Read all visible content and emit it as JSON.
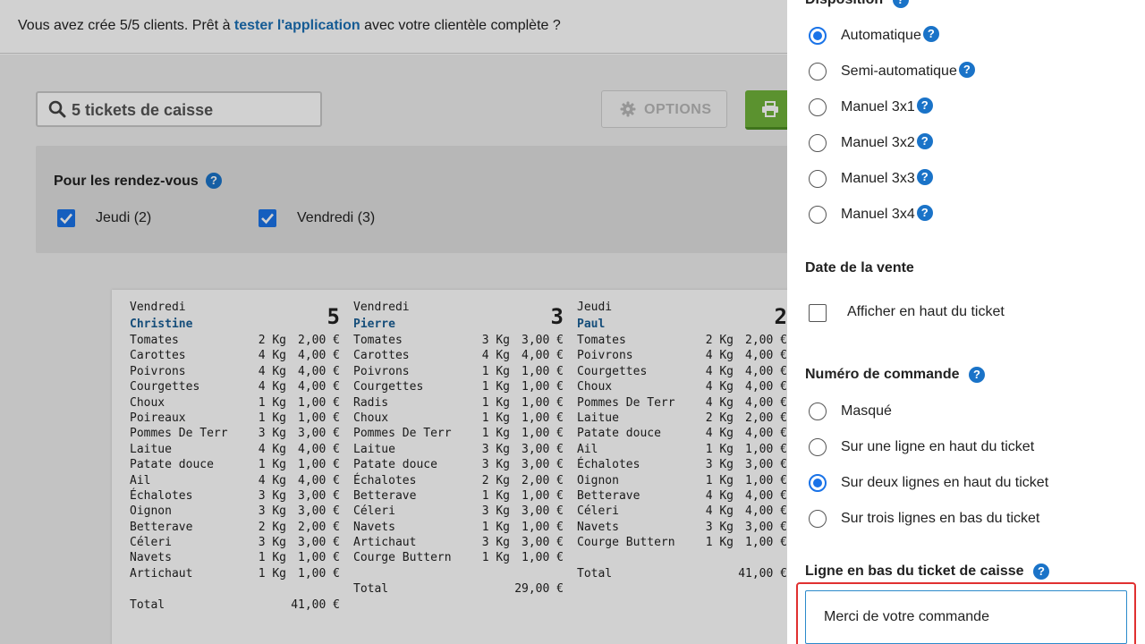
{
  "banner": {
    "text_before": "Vous avez crée 5/5 clients. Prêt à ",
    "link": "tester l'application",
    "text_after": " avec votre clientèle complète ?"
  },
  "toolbar": {
    "search_value": "5 tickets de caisse",
    "options_label": "OPTIONS"
  },
  "filters": {
    "title": "Pour les rendez-vous",
    "days": [
      {
        "label": "Jeudi (2)",
        "checked": true
      },
      {
        "label": "Vendredi (3)",
        "checked": true
      }
    ]
  },
  "tickets": [
    {
      "day": "Vendredi",
      "number": "5",
      "client": "Christine",
      "items": [
        [
          "Tomates",
          "2 Kg",
          "2,00 €"
        ],
        [
          "Carottes",
          "4 Kg",
          "4,00 €"
        ],
        [
          "Poivrons",
          "4 Kg",
          "4,00 €"
        ],
        [
          "Courgettes",
          "4 Kg",
          "4,00 €"
        ],
        [
          "Choux",
          "1 Kg",
          "1,00 €"
        ],
        [
          "Poireaux",
          "1 Kg",
          "1,00 €"
        ],
        [
          "Pommes De Terr",
          "3 Kg",
          "3,00 €"
        ],
        [
          "Laitue",
          "4 Kg",
          "4,00 €"
        ],
        [
          "Patate douce",
          "1 Kg",
          "1,00 €"
        ],
        [
          "Ail",
          "4 Kg",
          "4,00 €"
        ],
        [
          "Échalotes",
          "3 Kg",
          "3,00 €"
        ],
        [
          "Oignon",
          "3 Kg",
          "3,00 €"
        ],
        [
          "Betterave",
          "2 Kg",
          "2,00 €"
        ],
        [
          "Céleri",
          "3 Kg",
          "3,00 €"
        ],
        [
          "Navets",
          "1 Kg",
          "1,00 €"
        ],
        [
          "Artichaut",
          "1 Kg",
          "1,00 €"
        ]
      ],
      "total_label": "Total",
      "total": "41,00 €"
    },
    {
      "day": "Vendredi",
      "number": "3",
      "client": "Pierre",
      "items": [
        [
          "Tomates",
          "3 Kg",
          "3,00 €"
        ],
        [
          "Carottes",
          "4 Kg",
          "4,00 €"
        ],
        [
          "Poivrons",
          "1 Kg",
          "1,00 €"
        ],
        [
          "Courgettes",
          "1 Kg",
          "1,00 €"
        ],
        [
          "Radis",
          "1 Kg",
          "1,00 €"
        ],
        [
          "Choux",
          "1 Kg",
          "1,00 €"
        ],
        [
          "Pommes De Terr",
          "1 Kg",
          "1,00 €"
        ],
        [
          "Laitue",
          "3 Kg",
          "3,00 €"
        ],
        [
          "Patate douce",
          "3 Kg",
          "3,00 €"
        ],
        [
          "Échalotes",
          "2 Kg",
          "2,00 €"
        ],
        [
          "Betterave",
          "1 Kg",
          "1,00 €"
        ],
        [
          "Céleri",
          "3 Kg",
          "3,00 €"
        ],
        [
          "Navets",
          "1 Kg",
          "1,00 €"
        ],
        [
          "Artichaut",
          "3 Kg",
          "3,00 €"
        ],
        [
          "Courge Buttern",
          "1 Kg",
          "1,00 €"
        ]
      ],
      "total_label": "Total",
      "total": "29,00 €"
    },
    {
      "day": "Jeudi",
      "number": "2",
      "client": "Paul",
      "items": [
        [
          "Tomates",
          "2 Kg",
          "2,00 €"
        ],
        [
          "Poivrons",
          "4 Kg",
          "4,00 €"
        ],
        [
          "Courgettes",
          "4 Kg",
          "4,00 €"
        ],
        [
          "Choux",
          "4 Kg",
          "4,00 €"
        ],
        [
          "Pommes De Terr",
          "4 Kg",
          "4,00 €"
        ],
        [
          "Laitue",
          "2 Kg",
          "2,00 €"
        ],
        [
          "Patate douce",
          "4 Kg",
          "4,00 €"
        ],
        [
          "Ail",
          "1 Kg",
          "1,00 €"
        ],
        [
          "Échalotes",
          "3 Kg",
          "3,00 €"
        ],
        [
          "Oignon",
          "1 Kg",
          "1,00 €"
        ],
        [
          "Betterave",
          "4 Kg",
          "4,00 €"
        ],
        [
          "Céleri",
          "4 Kg",
          "4,00 €"
        ],
        [
          "Navets",
          "3 Kg",
          "3,00 €"
        ],
        [
          "Courge Buttern",
          "1 Kg",
          "1,00 €"
        ]
      ],
      "total_label": "Total",
      "total": "41,00 €"
    }
  ],
  "panel": {
    "disposition": {
      "title": "Disposition",
      "options": [
        {
          "label": "Automatique",
          "selected": true,
          "help": true
        },
        {
          "label": "Semi-automatique",
          "selected": false,
          "help": true
        },
        {
          "label": "Manuel 3x1",
          "selected": false,
          "help": true
        },
        {
          "label": "Manuel 3x2",
          "selected": false,
          "help": true
        },
        {
          "label": "Manuel 3x3",
          "selected": false,
          "help": true
        },
        {
          "label": "Manuel 3x4",
          "selected": false,
          "help": true
        }
      ]
    },
    "date": {
      "title": "Date de la vente",
      "checkbox_label": "Afficher en haut du ticket",
      "checked": false
    },
    "order_number": {
      "title": "Numéro de commande",
      "options": [
        {
          "label": "Masqué",
          "selected": false
        },
        {
          "label": "Sur une ligne en haut du ticket",
          "selected": false
        },
        {
          "label": "Sur deux lignes en haut du ticket",
          "selected": true
        },
        {
          "label": "Sur trois lignes en bas du ticket",
          "selected": false
        }
      ]
    },
    "footer_line": {
      "title": "Ligne en bas du ticket de caisse",
      "value": "Merci de votre commande"
    }
  },
  "icons": {
    "help_glyph": "?"
  },
  "colors": {
    "accent": "#1a73e8",
    "link": "#1a6fb5",
    "print_button": "#6fb33a",
    "highlight_border": "#e03030"
  }
}
